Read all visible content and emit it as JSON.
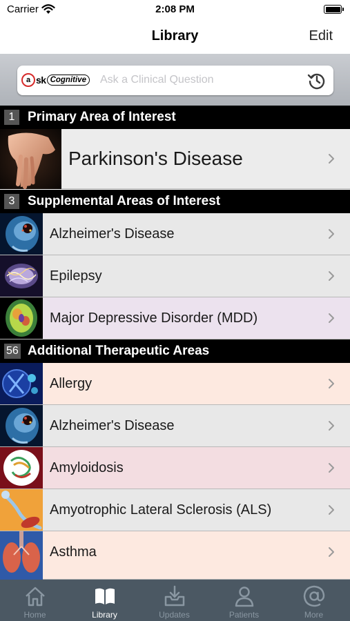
{
  "status_bar": {
    "carrier": "Carrier",
    "time": "2:08 PM"
  },
  "nav": {
    "title": "Library",
    "edit_label": "Edit"
  },
  "search": {
    "brand_q": "a",
    "brand_sk": "sk",
    "brand_cognitive": "Cognitive",
    "placeholder": "Ask a Clinical Question"
  },
  "sections": [
    {
      "count": "1",
      "title": "Primary Area of Interest"
    },
    {
      "count": "3",
      "title": "Supplemental Areas of Interest"
    },
    {
      "count": "56",
      "title": "Additional Therapeutic Areas"
    }
  ],
  "primary": {
    "label": "Parkinson's Disease"
  },
  "supplemental": [
    {
      "label": "Alzheimer's Disease",
      "color": "#e8e8e8"
    },
    {
      "label": "Epilepsy",
      "color": "#e8e8e8"
    },
    {
      "label": "Major Depressive Disorder (MDD)",
      "color": "#ece2ee"
    }
  ],
  "additional": [
    {
      "label": "Allergy",
      "color": "#fde9e0"
    },
    {
      "label": "Alzheimer's Disease",
      "color": "#e8e8e8"
    },
    {
      "label": "Amyloidosis",
      "color": "#f3dde1"
    },
    {
      "label": "Amyotrophic Lateral Sclerosis (ALS)",
      "color": "#e8e8e8"
    },
    {
      "label": "Asthma",
      "color": "#fde9e0"
    }
  ],
  "tabs": [
    {
      "label": "Home",
      "icon": "home-icon",
      "active": false
    },
    {
      "label": "Library",
      "icon": "book-icon",
      "active": true
    },
    {
      "label": "Updates",
      "icon": "inbox-download-icon",
      "active": false
    },
    {
      "label": "Patients",
      "icon": "person-icon",
      "active": false
    },
    {
      "label": "More",
      "icon": "at-sign-icon",
      "active": false
    }
  ],
  "colors": {
    "section_header": "#000000",
    "tab_bar": "#4b5863",
    "tab_active": "#ffffff",
    "tab_inactive": "#8a97a2",
    "primary_row": "#ececec"
  }
}
